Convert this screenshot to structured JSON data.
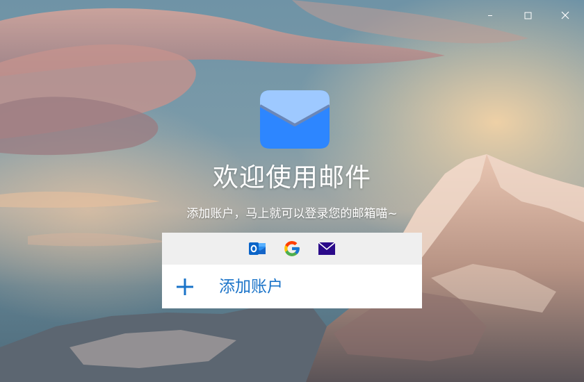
{
  "window": {
    "controls": {
      "minimize_icon": "minimize-icon",
      "maximize_icon": "maximize-icon",
      "close_icon": "close-icon"
    }
  },
  "welcome": {
    "logo_icon": "envelope-icon",
    "title": "欢迎使用邮件",
    "subtitle": "添加账户，马上就可以登录您的邮箱喵~"
  },
  "providers": [
    {
      "name": "outlook",
      "icon": "outlook-icon",
      "color": "#0a64c8"
    },
    {
      "name": "google",
      "icon": "google-icon",
      "color": "#4285f4"
    },
    {
      "name": "mail",
      "icon": "envelope-icon",
      "color": "#2b0a8a"
    }
  ],
  "add_account": {
    "icon": "plus-icon",
    "label": "添加账户",
    "color": "#1a73c8"
  },
  "colors": {
    "logo_blue": "#2d86ff",
    "logo_flap": "#9ec9ff",
    "provider_bar_bg": "#efefef"
  }
}
